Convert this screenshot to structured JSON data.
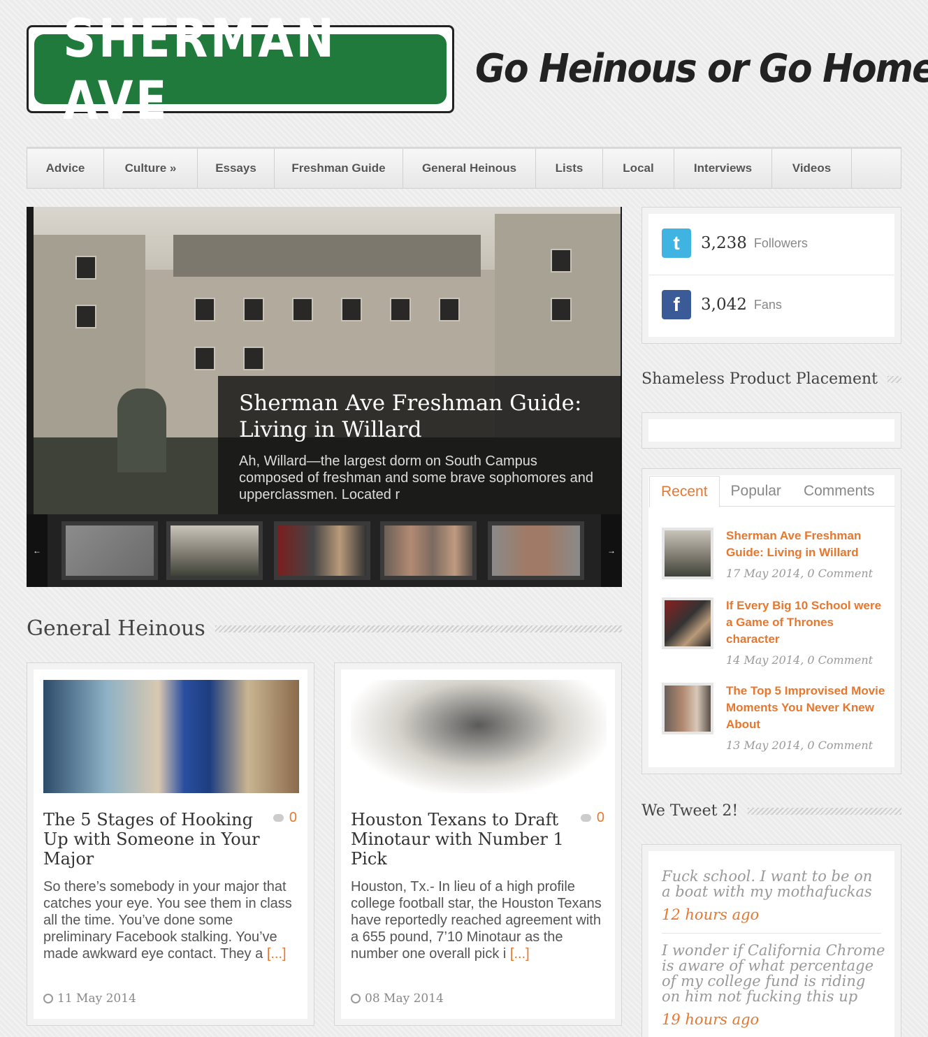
{
  "header": {
    "logo_text": "SHERMAN AVE",
    "tagline": "Go Heinous or Go Home"
  },
  "nav": {
    "items": [
      {
        "label": "Advice"
      },
      {
        "label": "Culture »"
      },
      {
        "label": "Essays"
      },
      {
        "label": "Freshman Guide"
      },
      {
        "label": "General Heinous"
      },
      {
        "label": "Lists"
      },
      {
        "label": "Local"
      },
      {
        "label": "Interviews"
      },
      {
        "label": "Videos"
      }
    ]
  },
  "slider": {
    "title": "Sherman Ave Freshman Guide: Living in Willard",
    "excerpt": "Ah, Willard—the largest dorm on South Campus composed of freshman and some brave sophomores and upperclassmen. Located r",
    "prev": "←",
    "next": "→"
  },
  "section": {
    "title": "General Heinous"
  },
  "posts": [
    {
      "title": "The 5 Stages of Hooking Up with Someone in Your Major",
      "comments": "0",
      "excerpt": "So there’s somebody in your major that catches your eye. You see them in class all the time. You’ve done some preliminary Facebook stalking. You’ve made awkward eye contact. They a",
      "more": "[...]",
      "date": "11 May 2014"
    },
    {
      "title": "Houston Texans to Draft Minotaur with Number 1 Pick",
      "comments": "0",
      "excerpt": "Houston, Tx.- In lieu of a high profile college football star, the Houston Texans have reportedly reached agreement with a 655 pound, 7’10 Minotaur as the number one overall pick i",
      "more": "[...]",
      "date": "08 May 2014"
    }
  ],
  "social": {
    "twitter": {
      "count": "3,238",
      "label": "Followers"
    },
    "facebook": {
      "count": "3,042",
      "label": "Fans"
    }
  },
  "sidebar": {
    "product_heading": "Shameless Product Placement",
    "tabs": [
      "Recent",
      "Popular",
      "Comments"
    ],
    "recent": [
      {
        "title": "Sherman Ave Freshman Guide: Living in Willard",
        "meta": "17 May 2014, 0 Comment"
      },
      {
        "title": "If Every Big 10 School were a Game of Thrones character",
        "meta": "14 May 2014, 0 Comment"
      },
      {
        "title": "The Top 5 Improvised Movie Moments You Never Knew About",
        "meta": "13 May 2014, 0 Comment"
      }
    ],
    "tweets_heading": "We Tweet 2!",
    "tweets": [
      {
        "text": "Fuck school. I want to be on a boat with my mothafuckas",
        "time": "12 hours ago"
      },
      {
        "text": "I wonder if California Chrome is aware of what percentage of my college fund is riding on him not fucking this up",
        "time": "19 hours ago"
      }
    ]
  },
  "colors": {
    "accent": "#e8772e",
    "logo_green": "#1f7a3c",
    "twitter_blue": "#3fb3e2",
    "facebook_blue": "#3b5b98"
  }
}
